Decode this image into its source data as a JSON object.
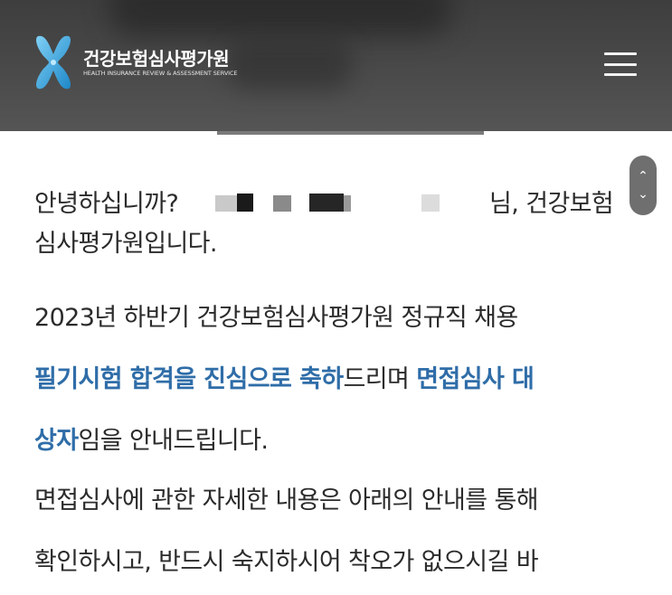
{
  "header": {
    "org_name": "건강보험심사평가원",
    "org_sub": "HEALTH INSURANCE REVIEW & ASSESSMENT SERVICE",
    "bg_color": "#4a4a4a",
    "logo_color": "#3fa9e0"
  },
  "menu": {
    "icon": "hamburger-menu-icon"
  },
  "scroll": {
    "up_icon": "chevron-up-icon",
    "down_icon": "chevron-down-icon"
  },
  "message": {
    "greeting_prefix": "안녕하십니까?",
    "greeting_suffix": "님, 건강보험",
    "greeting_line2": "심사평가원입니다.",
    "notice_line1": "2023년 하반기 건강보험심사평가원 정규직 채용",
    "highlight1": "필기시험 합격을 진심으로 축하",
    "connector": "드리며 ",
    "highlight2a": "면접심사 대",
    "highlight2b": "상자",
    "notice_end": "임을 안내드립니다.",
    "info_line1": "면접심사에 관한 자세한 내용은 아래의 안내를 통해",
    "info_line2": "확인하시고, 반드시 숙지하시어 착오가 없으시길 바",
    "highlight_color": "#2f6da8"
  }
}
